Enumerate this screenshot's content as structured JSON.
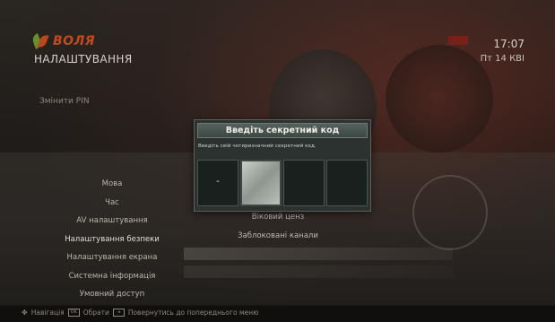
{
  "header": {
    "brand": "ВОЛЯ",
    "title": "НАЛАШТУВАННЯ",
    "time": "17:07",
    "date": "Пт 14 КВІ"
  },
  "change_pin_label": "Змінити PIN",
  "menu": {
    "items": [
      "Мова",
      "Час",
      "AV налаштування",
      "Налаштування безпеки",
      "Налаштування екрана",
      "Системна інформація",
      "Умовний доступ"
    ],
    "selected_index": 3
  },
  "submenu": {
    "items": [
      "Віковий ценз",
      "Заблоковані канали"
    ]
  },
  "dialog": {
    "title": "Введіть секретний код",
    "message": "Введіть свій чотиризначний секретний код.",
    "pin_slots": [
      "-",
      "",
      "",
      ""
    ],
    "active_slot": 1
  },
  "footer": {
    "items": [
      {
        "icon": "navigation-icon",
        "label": "Навігація"
      },
      {
        "icon": "ok-key-icon",
        "label": "Обрати"
      },
      {
        "icon": "back-key-icon",
        "label": "Повернутись до попереднього меню"
      }
    ]
  }
}
